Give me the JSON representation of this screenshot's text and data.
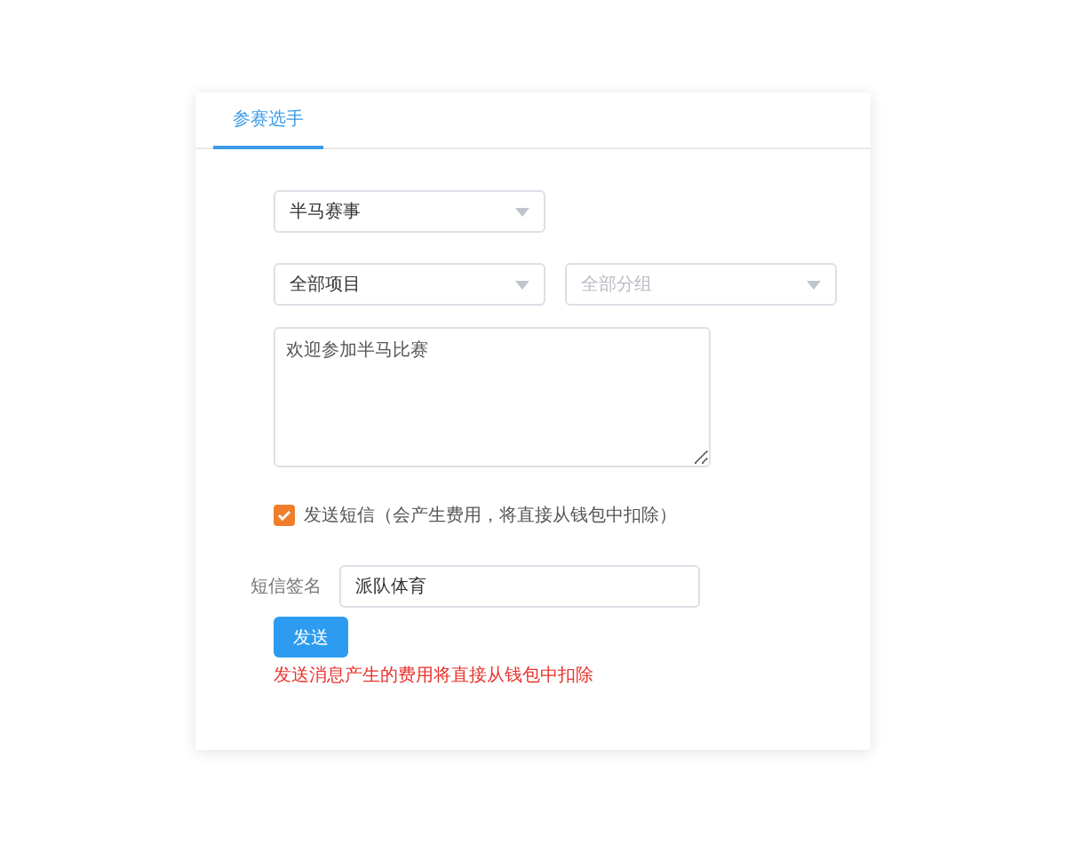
{
  "tabs": [
    {
      "label": "参赛选手",
      "selected": true
    }
  ],
  "event_select": {
    "value": "半马赛事"
  },
  "filters": [
    {
      "value": "全部项目"
    },
    {
      "placeholder": "全部分组"
    }
  ],
  "message": {
    "value": "欢迎参加半马比赛"
  },
  "send_sms": {
    "label": "发送短信（会产生费用，将直接从钱包中扣除）",
    "checked": true
  },
  "signature": {
    "label": "短信签名",
    "value": "派队体育"
  },
  "send_button": "发送",
  "warning": "发送消息产生的费用将直接从钱包中扣除"
}
